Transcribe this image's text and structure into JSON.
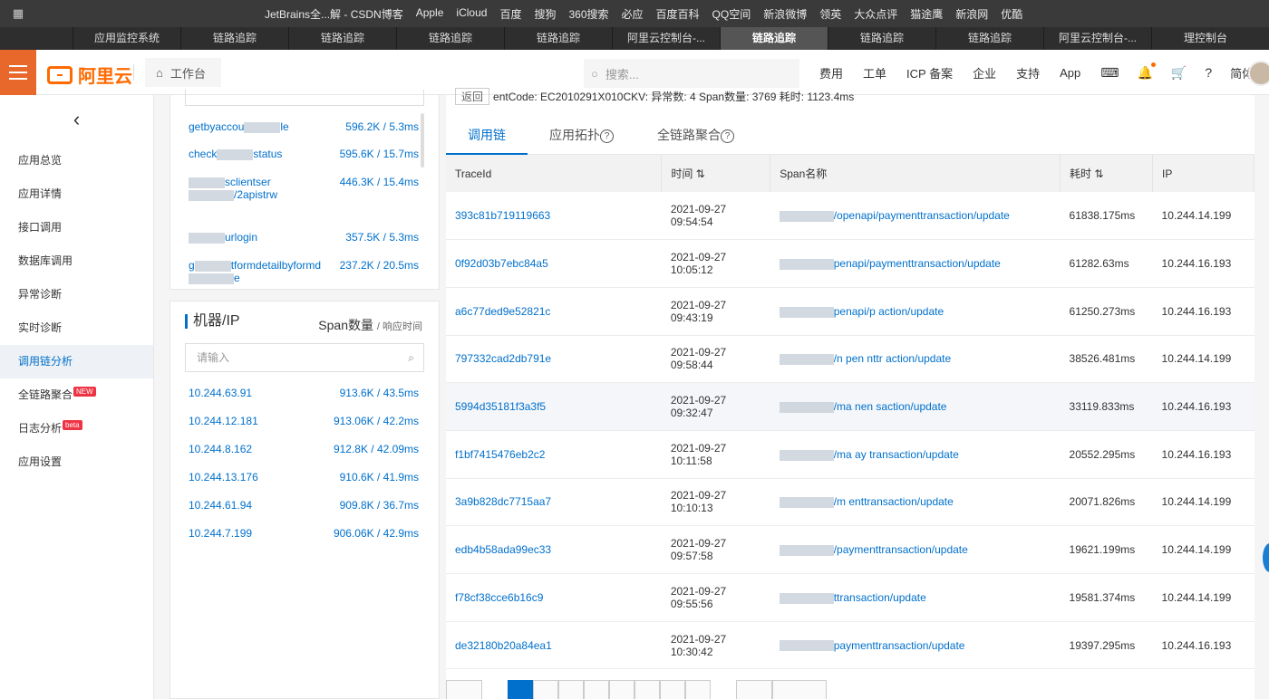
{
  "bookmarks": [
    "JetBrains全...解 - CSDN博客",
    "Apple",
    "iCloud",
    "百度",
    "搜狗",
    "360搜索",
    "必应",
    "百度百科",
    "QQ空间",
    "新浪微博",
    "领英",
    "大众点评",
    "猫途鹰",
    "新浪网",
    "优酷"
  ],
  "browser_tabs": [
    "",
    "应用监控系统",
    "链路追踪",
    "链路追踪",
    "链路追踪",
    "链路追踪",
    "阿里云控制台-...",
    "链路追踪",
    "链路追踪",
    "链路追踪",
    "阿里云控制台-...",
    "理控制台"
  ],
  "active_browser_tab": 7,
  "header": {
    "logo": "阿里云",
    "workbench": "工作台",
    "search_placeholder": "搜索...",
    "nav": [
      "费用",
      "工单",
      "ICP 备案",
      "企业",
      "支持",
      "App"
    ],
    "lang": "简体"
  },
  "sidebar": {
    "items": [
      {
        "label": "应用总览",
        "tag": ""
      },
      {
        "label": "应用详情",
        "tag": ""
      },
      {
        "label": "接口调用",
        "tag": ""
      },
      {
        "label": "数据库调用",
        "tag": ""
      },
      {
        "label": "异常诊断",
        "tag": ""
      },
      {
        "label": "实时诊断",
        "tag": ""
      },
      {
        "label": "调用链分析",
        "tag": ""
      },
      {
        "label": "全链路聚合",
        "tag": "NEW"
      },
      {
        "label": "日志分析",
        "tag": "beta"
      },
      {
        "label": "应用设置",
        "tag": ""
      }
    ],
    "active_index": 6
  },
  "interfaces": [
    {
      "name": "getbyaccou",
      "suffix": "le",
      "value": "596.2K / 5.3ms"
    },
    {
      "name": "check",
      "suffix": "status",
      "value": "595.6K / 15.7ms"
    },
    {
      "name": "",
      "suffix": "sclientser",
      "suffix2": "/2apistrw",
      "value": "446.3K / 15.4ms"
    },
    {
      "name": "",
      "suffix": "urlogin",
      "value": "357.5K / 5.3ms"
    },
    {
      "name": "g",
      "suffix": "tformdetailbyformd",
      "suffix2": "e",
      "value": "237.2K / 20.5ms"
    }
  ],
  "machines": {
    "title": "机器/IP",
    "sub_main": "Span数量",
    "sub_small": "/ 响应时间",
    "placeholder": "请输入",
    "rows": [
      {
        "ip": "10.244.63.91",
        "value": "913.6K / 43.5ms"
      },
      {
        "ip": "10.244.12.181",
        "value": "913.06K / 42.2ms"
      },
      {
        "ip": "10.244.8.162",
        "value": "912.8K / 42.09ms"
      },
      {
        "ip": "10.244.13.176",
        "value": "910.6K / 41.9ms"
      },
      {
        "ip": "10.244.61.94",
        "value": "909.8K / 36.7ms"
      },
      {
        "ip": "10.244.7.199",
        "value": "906.06K / 42.9ms"
      }
    ]
  },
  "main": {
    "back": "返回",
    "crumb_text": "entCode: EC2010291X010CKV: 异常数: 4 Span数量: 3769 耗时: 1123.4ms",
    "tabs": [
      "调用链",
      "应用拓扑",
      "全链路聚合"
    ],
    "columns": [
      "TraceId",
      "时间",
      "Span名称",
      "耗时",
      "IP"
    ],
    "rows": [
      {
        "trace": "393c81b719119663",
        "date": "2021-09-27",
        "time": "09:54:54",
        "span": "/openapi/paymenttransaction/update",
        "dur": "61838.175ms",
        "ip": "10.244.14.199"
      },
      {
        "trace": "0f92d03b7ebc84a5",
        "date": "2021-09-27",
        "time": "10:05:12",
        "span": "penapi/paymenttransaction/update",
        "dur": "61282.63ms",
        "ip": "10.244.16.193"
      },
      {
        "trace": "a6c77ded9e52821c",
        "date": "2021-09-27",
        "time": "09:43:19",
        "span": "penapi/p         action/update",
        "dur": "61250.273ms",
        "ip": "10.244.16.193"
      },
      {
        "trace": "797332cad2db791e",
        "date": "2021-09-27",
        "time": "09:58:44",
        "span": "/n      pen      nttr   action/update",
        "dur": "38526.481ms",
        "ip": "10.244.14.199"
      },
      {
        "trace": "5994d35181f3a3f5",
        "date": "2021-09-27",
        "time": "09:32:47",
        "span": "/ma              nen  saction/update",
        "dur": "33119.833ms",
        "ip": "10.244.16.193"
      },
      {
        "trace": "f1bf7415476eb2c2",
        "date": "2021-09-27",
        "time": "10:11:58",
        "span": "/ma          ay  transaction/update",
        "dur": "20552.295ms",
        "ip": "10.244.16.193"
      },
      {
        "trace": "3a9b828dc7715aa7",
        "date": "2021-09-27",
        "time": "10:10:13",
        "span": "/m           enttransaction/update",
        "dur": "20071.826ms",
        "ip": "10.244.14.199"
      },
      {
        "trace": "edb4b58ada99ec33",
        "date": "2021-09-27",
        "time": "09:57:58",
        "span": "/paymenttransaction/update",
        "dur": "19621.199ms",
        "ip": "10.244.14.199"
      },
      {
        "trace": "f78cf38cce6b16c9",
        "date": "2021-09-27",
        "time": "09:55:56",
        "span": "ttransaction/update",
        "dur": "19581.374ms",
        "ip": "10.244.14.199"
      },
      {
        "trace": "de32180b20a84ea1",
        "date": "2021-09-27",
        "time": "10:30:42",
        "span": "paymenttransaction/update",
        "dur": "19397.295ms",
        "ip": "10.244.16.193"
      }
    ],
    "highlighted_row": 4
  }
}
